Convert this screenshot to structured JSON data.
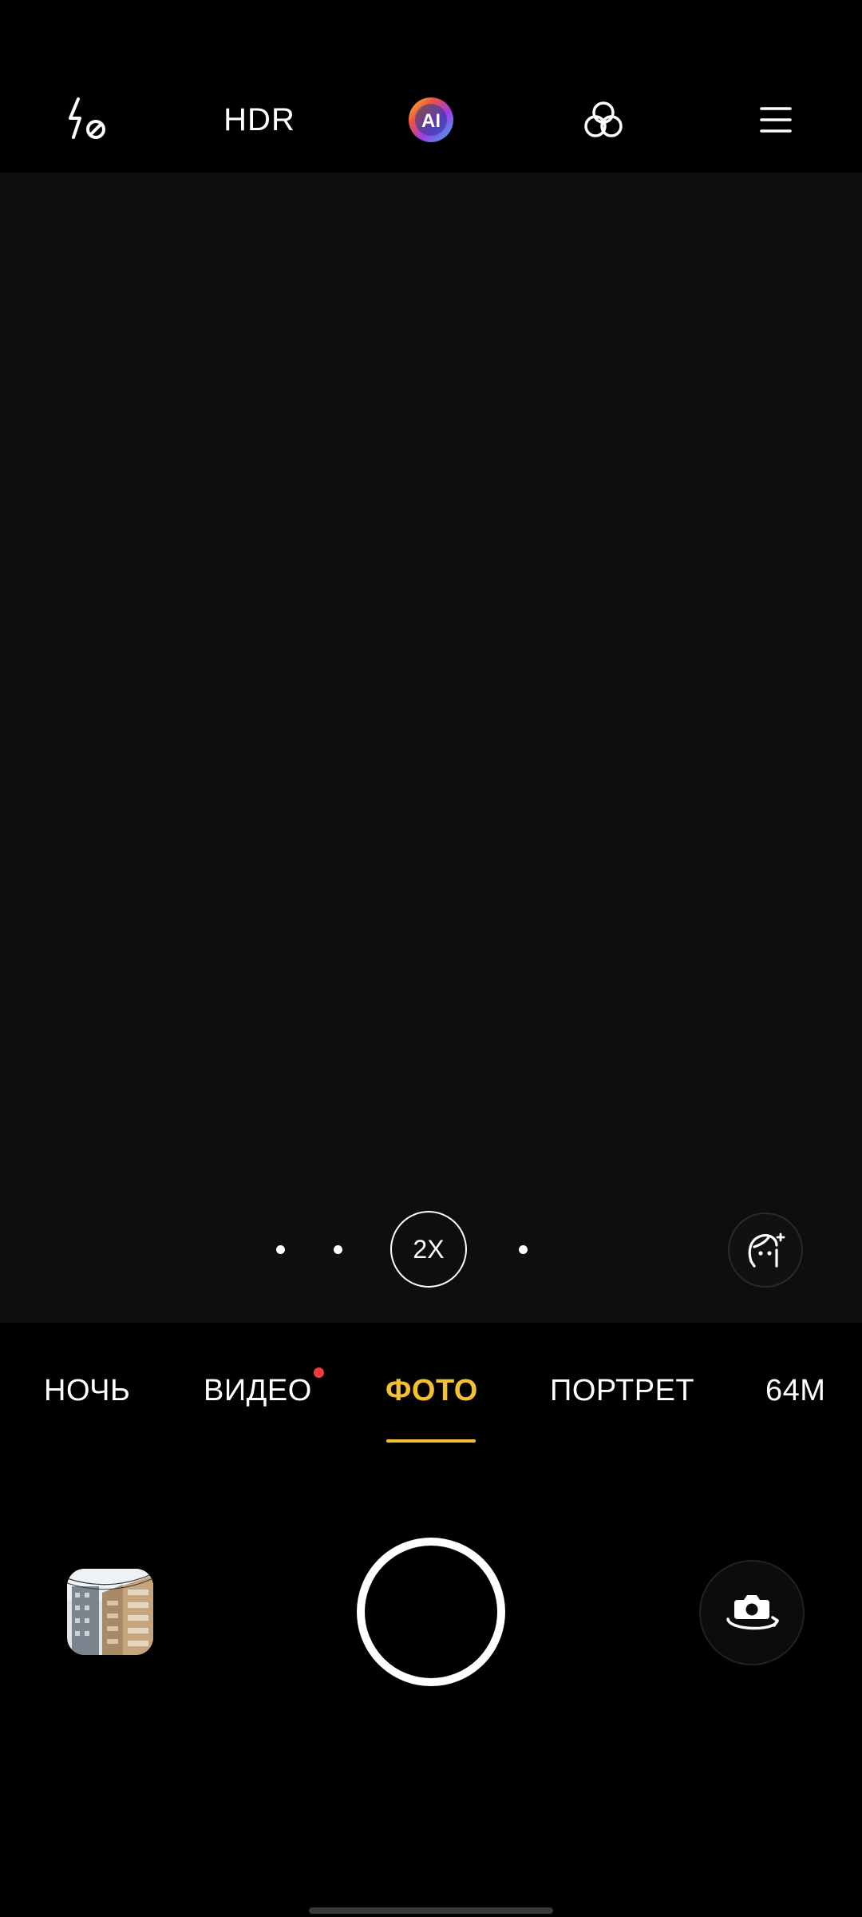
{
  "top_bar": {
    "flash_icon": "flash-off-icon",
    "hdr_label": "HDR",
    "ai_label": "AI",
    "filter_icon": "filters-icon",
    "menu_icon": "menu-icon"
  },
  "viewfinder": {
    "zoom_levels_label": "2X",
    "beauty_icon": "beauty-face-icon"
  },
  "modes": {
    "items": [
      {
        "label": "НОЧЬ"
      },
      {
        "label": "ВИДЕО"
      },
      {
        "label": "ФОТО"
      },
      {
        "label": "ПОРТРЕТ"
      },
      {
        "label": "64M"
      }
    ],
    "active": "ФОТО"
  },
  "controls": {
    "gallery_icon": "gallery-thumbnail",
    "shutter_icon": "shutter-icon",
    "switch_icon": "switch-camera-icon"
  },
  "colors": {
    "accent": "#f5c033",
    "notification_dot": "#ef3d3d",
    "viewfinder_bg": "#0f0d0e"
  }
}
